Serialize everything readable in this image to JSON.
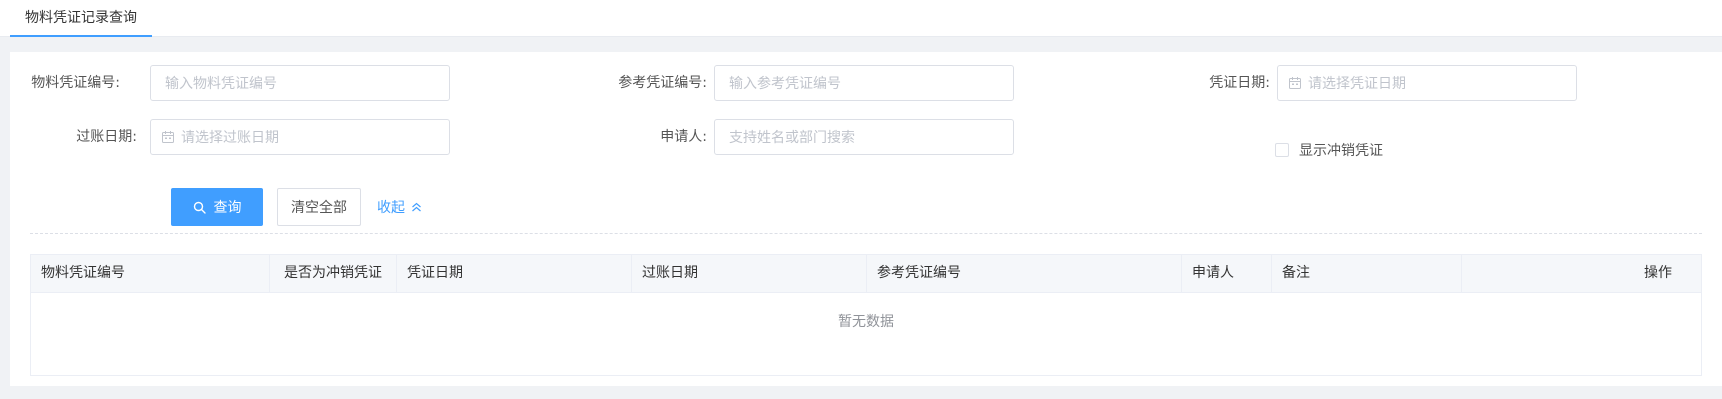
{
  "tabs": [
    {
      "label": "物料凭证记录查询"
    }
  ],
  "form": {
    "material_doc_no": {
      "label": "物料凭证编号:",
      "placeholder": "输入物料凭证编号"
    },
    "ref_doc_no": {
      "label": "参考凭证编号:",
      "placeholder": "输入参考凭证编号"
    },
    "doc_date": {
      "label": "凭证日期:",
      "placeholder": "请选择凭证日期"
    },
    "posting_date": {
      "label": "过账日期:",
      "placeholder": "请选择过账日期"
    },
    "applicant": {
      "label": "申请人:",
      "placeholder": "支持姓名或部门搜索"
    },
    "show_reversal": {
      "label": "显示冲销凭证",
      "checked": false
    }
  },
  "actions": {
    "search_label": "查询",
    "clear_label": "清空全部",
    "collapse_label": "收起"
  },
  "table": {
    "columns": [
      "物料凭证编号",
      "是否为冲销凭证",
      "凭证日期",
      "过账日期",
      "参考凭证编号",
      "申请人",
      "备注",
      "操作"
    ],
    "empty_text": "暂无数据"
  },
  "colors": {
    "accent": "#409eff",
    "background": "#f0f2f5"
  },
  "icons": {
    "search": "search-icon",
    "calendar": "calendar-icon",
    "collapse": "chevron-up-double-icon"
  }
}
